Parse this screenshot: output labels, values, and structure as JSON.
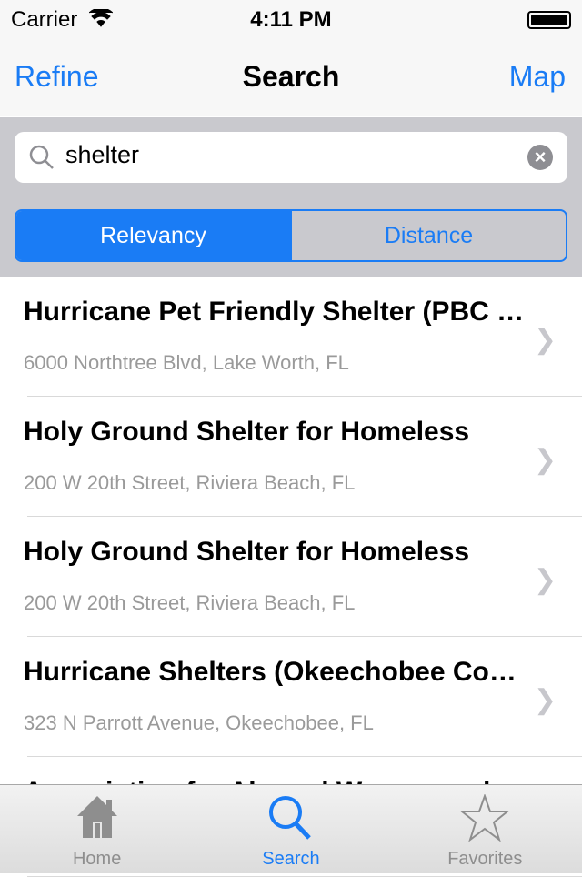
{
  "status": {
    "carrier": "Carrier",
    "time": "4:11 PM",
    "battery_percent": 100
  },
  "nav": {
    "left": "Refine",
    "title": "Search",
    "right": "Map"
  },
  "search": {
    "value": "shelter",
    "placeholder": ""
  },
  "segments": {
    "selected": "Relevancy",
    "items": [
      "Relevancy",
      "Distance"
    ]
  },
  "results": [
    {
      "title": "Hurricane Pet Friendly Shelter (PBC Fairgrounds)",
      "address": "6000 Northtree Blvd, Lake Worth, FL"
    },
    {
      "title": "Holy Ground Shelter for Homeless",
      "address": "200 W 20th Street, Riviera Beach, FL"
    },
    {
      "title": "Holy Ground Shelter for Homeless",
      "address": "200 W 20th Street, Riviera Beach, FL"
    },
    {
      "title": "Hurricane Shelters (Okeechobee County)",
      "address": "323 N Parrott Avenue, Okeechobee, FL"
    },
    {
      "title": "Association for Abused Women and",
      "address": ""
    }
  ],
  "tabs": [
    {
      "label": "Home",
      "icon": "house-icon"
    },
    {
      "label": "Search",
      "icon": "search-icon",
      "active": true
    },
    {
      "label": "Favorites",
      "icon": "star-icon"
    }
  ],
  "colors": {
    "accent": "#1a7cf5"
  }
}
